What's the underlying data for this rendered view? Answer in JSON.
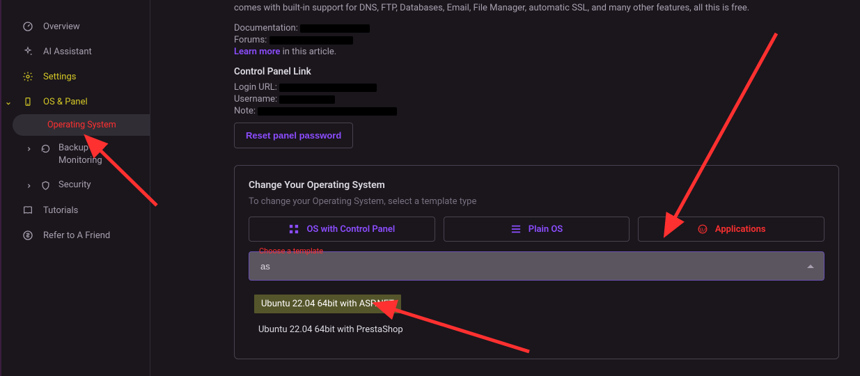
{
  "sidebar": {
    "overview": "Overview",
    "ai": "AI Assistant",
    "settings": "Settings",
    "ospanel": "OS & Panel",
    "os_sub": "Operating System",
    "backup": "Backup & Monitoring",
    "security": "Security",
    "tutorials": "Tutorials",
    "refer": "Refer to A Friend"
  },
  "header": {
    "intro": "comes with built-in support for DNS, FTP, Databases, Email, File Manager, automatic SSL, and many other features, all this is free.",
    "doc_label": "Documentation:",
    "forums_label": "Forums:",
    "learn_more": "Learn more",
    "learn_more_suffix": " in this article.",
    "cpl_title": "Control Panel Link",
    "login_label": "Login URL:",
    "user_label": "Username:",
    "note_label": "Note: ",
    "reset_btn": "Reset panel password"
  },
  "card": {
    "title": "Change Your Operating System",
    "desc": "To change your Operating System, select a template type",
    "tab1": "OS with Control Panel",
    "tab2": "Plain OS",
    "tab3": "Applications",
    "field_label": "Choose a template",
    "field_value": "as",
    "opt1": "Ubuntu 22.04 64bit with ASP.NET",
    "opt2": "Ubuntu 22.04 64bit with PrestaShop"
  }
}
